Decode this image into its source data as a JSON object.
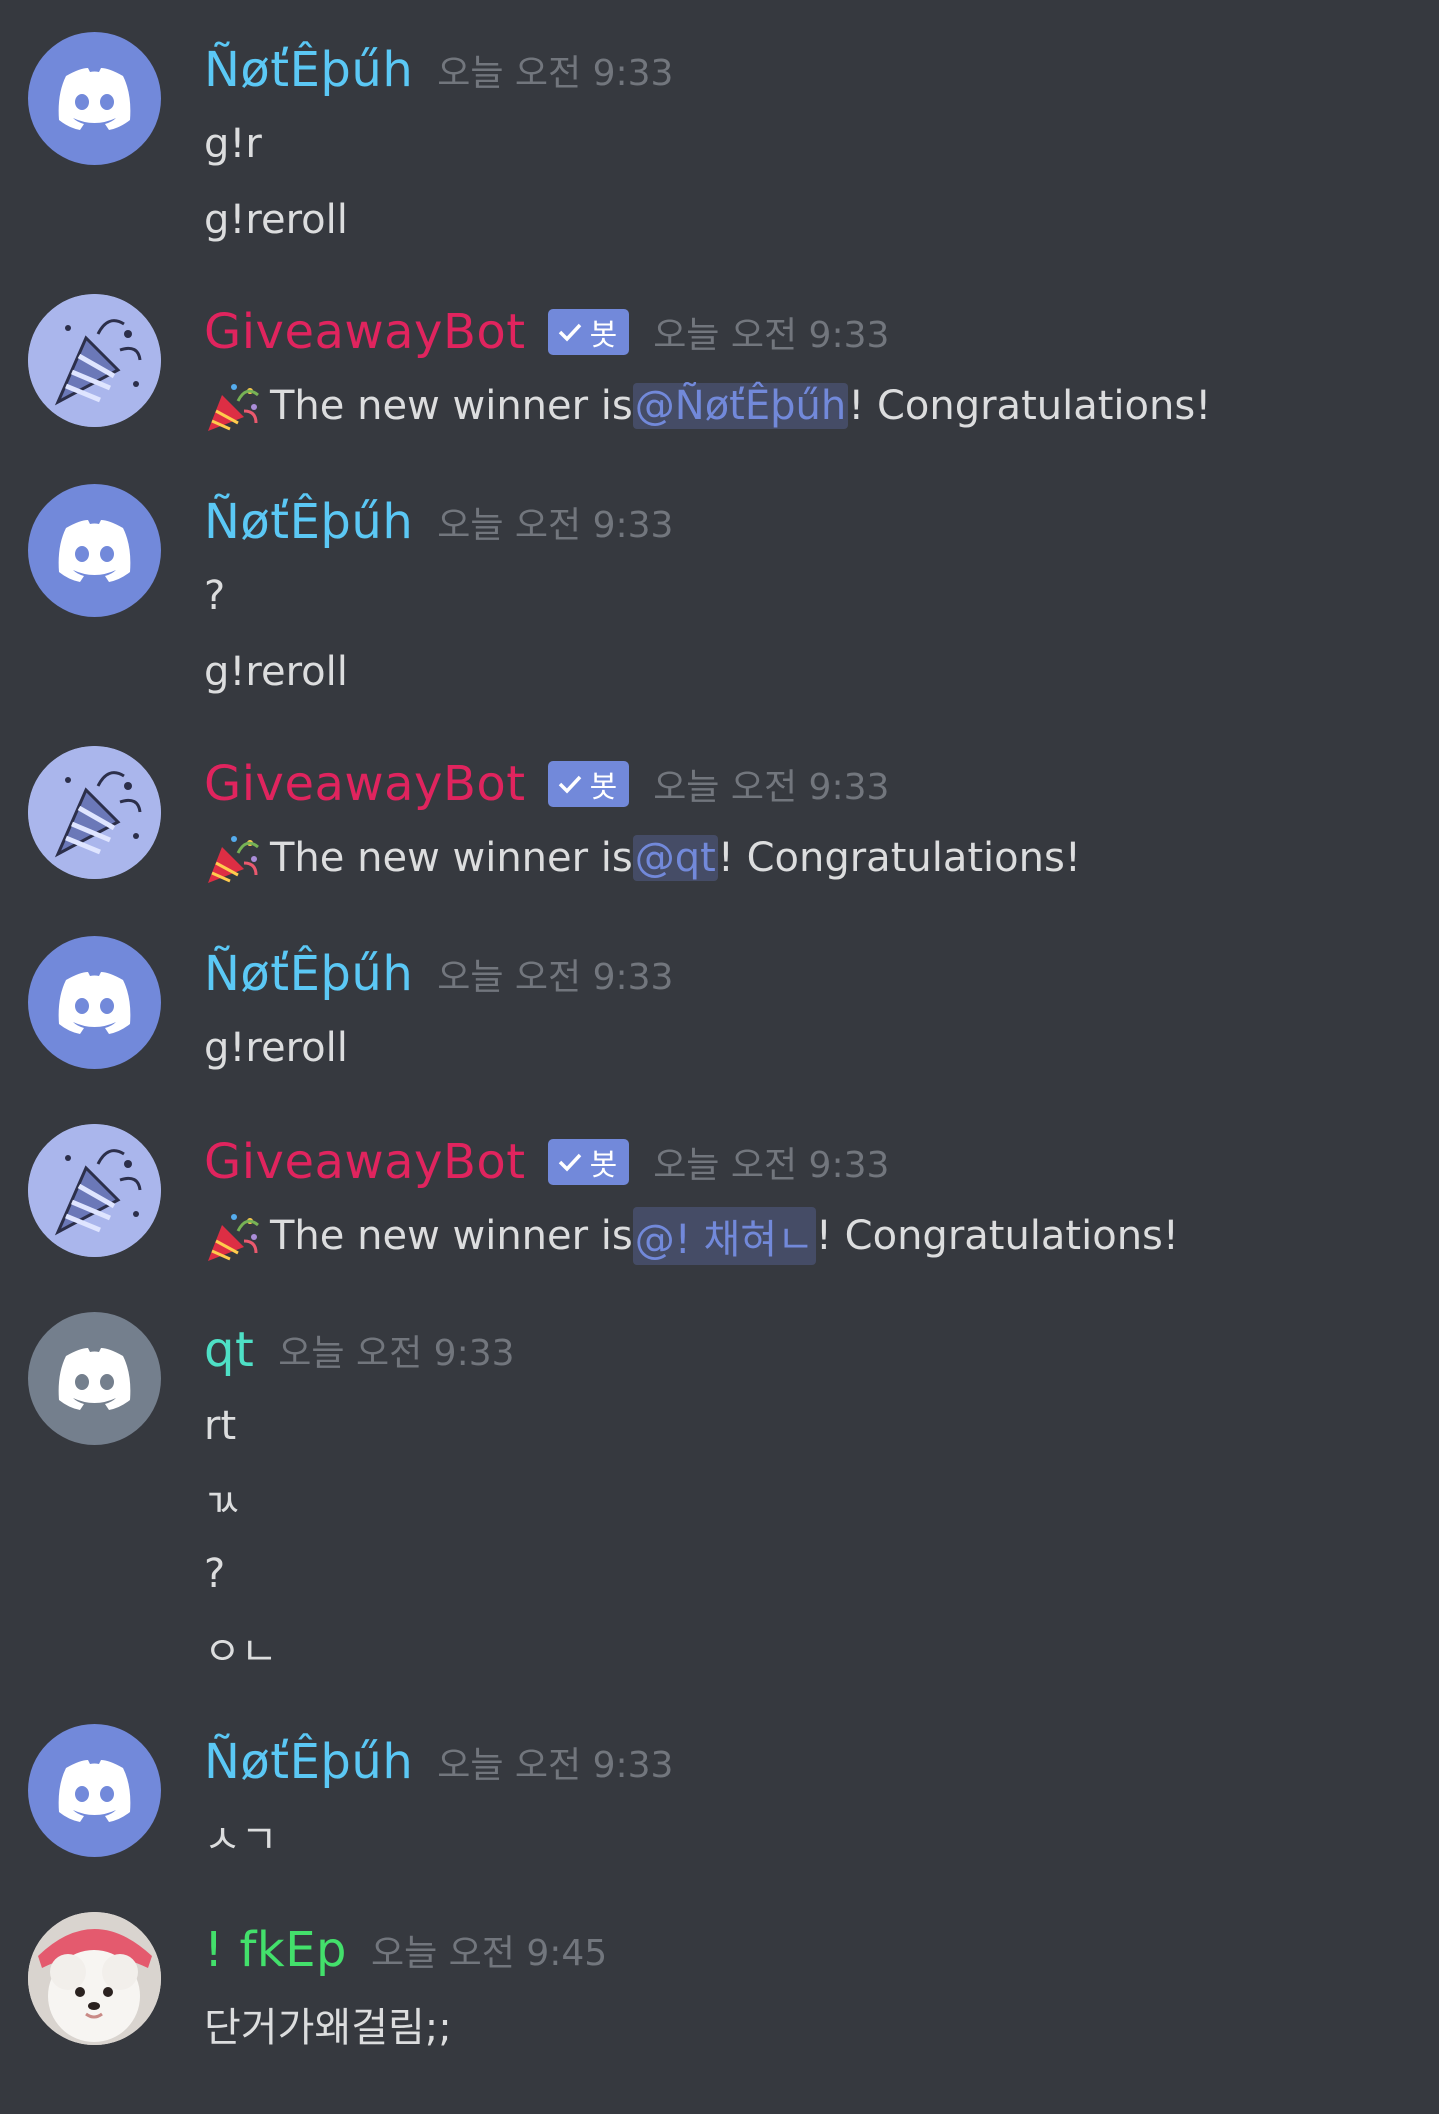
{
  "colors": {
    "background": "#36393f",
    "username_blue": "#5bc8f5",
    "username_bot": "#e0245e",
    "username_qt": "#4ee0c6",
    "username_green": "#43e06b",
    "timestamp": "#72767d",
    "mention": "#7289da",
    "bot_tag": "#7289da",
    "discord_blurple": "#7289da",
    "discord_gray": "#747f8d"
  },
  "bot_tag_label": "봇",
  "messages": [
    {
      "author": "ÑøťÊþűh",
      "avatar": "discord-logo-blurple",
      "timestamp": "오늘 오전 9:33",
      "lines": [
        "g!r",
        "g!reroll"
      ]
    },
    {
      "author": "GiveawayBot",
      "avatar": "party-popper-avatar",
      "is_bot": true,
      "timestamp": "오늘 오전 9:33",
      "content": {
        "prefix": "The new winner is ",
        "mention": "@ÑøťÊþűh",
        "suffix": "! Congratulations!"
      }
    },
    {
      "author": "ÑøťÊþűh",
      "avatar": "discord-logo-blurple",
      "timestamp": "오늘 오전 9:33",
      "lines": [
        "?",
        "g!reroll"
      ]
    },
    {
      "author": "GiveawayBot",
      "avatar": "party-popper-avatar",
      "is_bot": true,
      "timestamp": "오늘 오전 9:33",
      "content": {
        "prefix": "The new winner is ",
        "mention": "@qt",
        "suffix": "! Congratulations!"
      }
    },
    {
      "author": "ÑøťÊþűh",
      "avatar": "discord-logo-blurple",
      "timestamp": "오늘 오전 9:33",
      "lines": [
        "g!reroll"
      ]
    },
    {
      "author": "GiveawayBot",
      "avatar": "party-popper-avatar",
      "is_bot": true,
      "timestamp": "오늘 오전 9:33",
      "content": {
        "prefix": "The new winner is ",
        "mention": "@! 채혀ㄴ",
        "suffix": "! Congratulations!"
      }
    },
    {
      "author": "qt",
      "avatar": "discord-logo-gray",
      "timestamp": "오늘 오전 9:33",
      "lines": [
        "rt",
        "ㄳ",
        "?",
        "ㅇㄴ"
      ]
    },
    {
      "author": "ÑøťÊþűh",
      "avatar": "discord-logo-blurple",
      "timestamp": "오늘 오전 9:33",
      "lines": [
        "ㅅㄱ"
      ]
    },
    {
      "author": "! fkEp",
      "avatar": "dog-photo-avatar",
      "timestamp": "오늘 오전 9:45",
      "lines": [
        "단거가왜걸림;;"
      ]
    }
  ]
}
